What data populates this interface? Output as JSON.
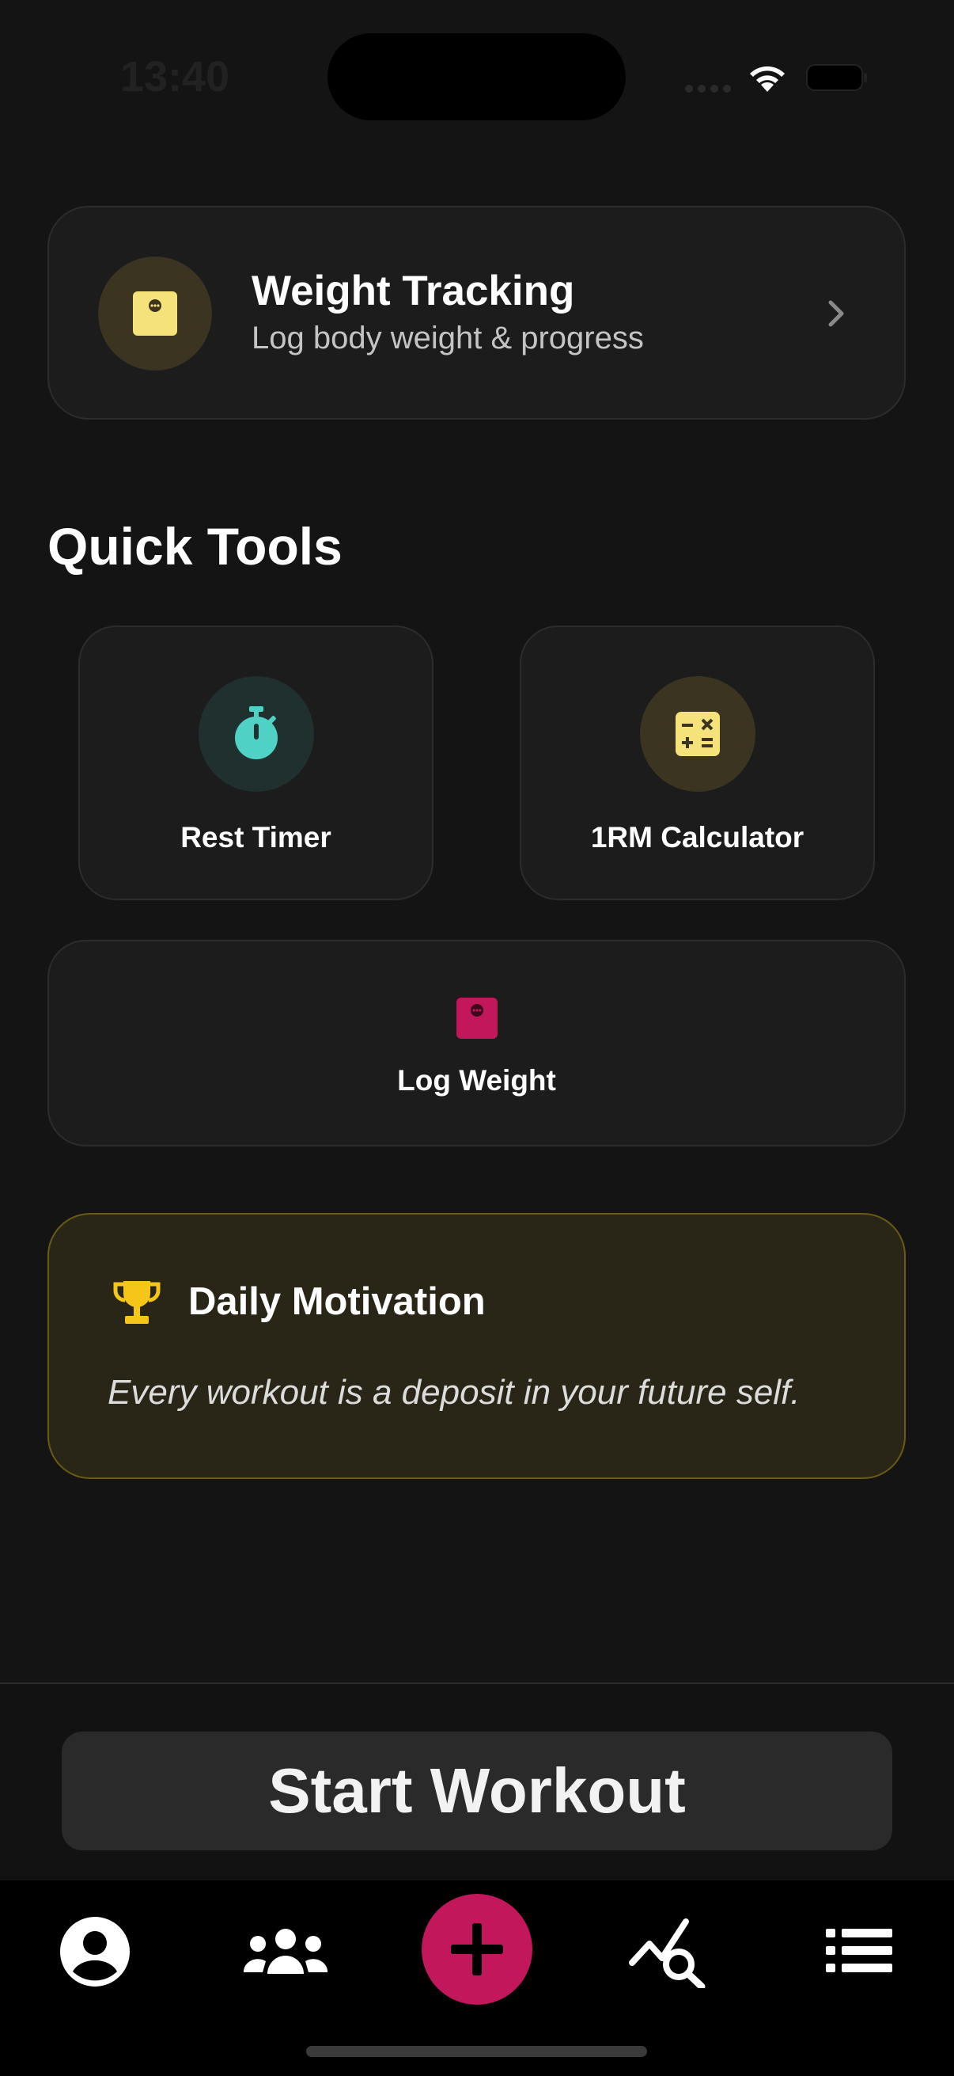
{
  "status_bar": {
    "time": "13:40"
  },
  "weight_tracking": {
    "title": "Weight Tracking",
    "subtitle": "Log body weight & progress",
    "icon": "scale-icon",
    "icon_color": "#f6e27a"
  },
  "quick_tools": {
    "title": "Quick Tools",
    "items": [
      {
        "label": "Rest Timer",
        "icon": "stopwatch-icon",
        "color": "#4fd1c5"
      },
      {
        "label": "1RM Calculator",
        "icon": "calculator-icon",
        "color": "#f6e27a"
      },
      {
        "label": "Log Weight",
        "icon": "scale-icon",
        "color": "#c2185b"
      }
    ]
  },
  "motivation": {
    "title": "Daily Motivation",
    "quote": "Every workout is a deposit in your future self.",
    "icon": "trophy-icon",
    "accent": "#f5c518"
  },
  "start_workout": {
    "label": "Start Workout"
  },
  "tab_bar": {
    "items": [
      {
        "icon": "profile-icon"
      },
      {
        "icon": "community-icon"
      },
      {
        "icon": "add-icon",
        "accent": "#c2185b"
      },
      {
        "icon": "analytics-icon"
      },
      {
        "icon": "list-icon"
      }
    ]
  }
}
